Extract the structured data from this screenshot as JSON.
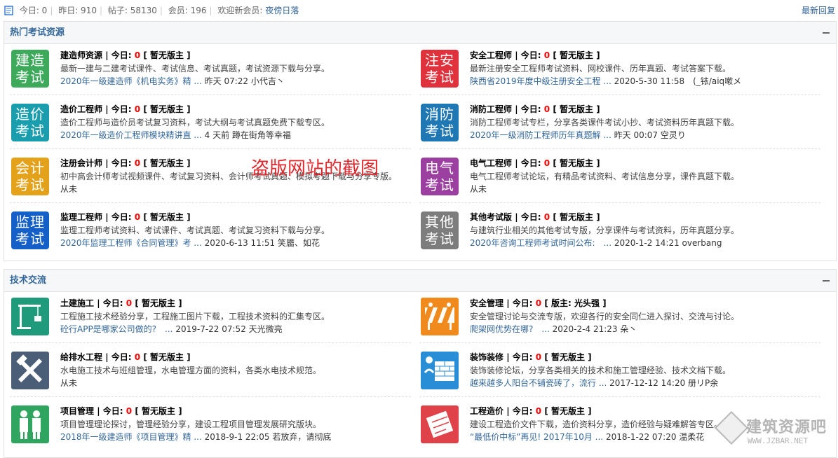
{
  "topbar": {
    "today_label": "今日: 0",
    "yesterday_label": "昨日: 910",
    "posts_label": "帖子: 58130",
    "members_label": "会员: 196",
    "welcome_label": "欢迎新会员:",
    "new_member": "夜傍日落",
    "latest_reply": "最新回复"
  },
  "annotation": "盗版网站的截图",
  "logo": {
    "main": "建筑资源吧",
    "sub": "WWW.JZBAR.NET"
  },
  "sections": [
    {
      "title": "热门考试资源",
      "forums": [
        {
          "icon_text": "建造考试",
          "icon_color": "#3daa5b",
          "name": "建造师资源",
          "today_label": "今日:",
          "today": "0",
          "moderator": "[ 暂无版主 ]",
          "desc": "最新一建与二建考试课件、考试信息、考试真题，考试资源下载与分享。",
          "last_title": "2020年一级建造师《机电实务》精 ...",
          "last_meta": "昨天 07:22 小代吉丶"
        },
        {
          "icon_text": "注安考试",
          "icon_color": "#e0323c",
          "name": "安全工程师",
          "today_label": "今日:",
          "today": "0",
          "moderator": "[ 暂无版主 ]",
          "desc": "最新注册安全工程师考试资料、网校课件、历年真题、考试答案下载。",
          "last_title": "陕西省2019年度中级注册安全工程 ...",
          "last_meta": "2020-5-30 11:58　(_铱/aiq嗽メ"
        },
        {
          "icon_text": "造价考试",
          "icon_color": "#1a9eae",
          "name": "造价工程师",
          "today_label": "今日:",
          "today": "0",
          "moderator": "[ 暂无版主 ]",
          "desc": "造价工程师与造价员考试复习资料，考试大纲与考试真题免费下载专区。",
          "last_title": "2020年一级造价工程师模块精讲直 ...",
          "last_meta": "4 天前 蹲在街角等幸福"
        },
        {
          "icon_text": "消防考试",
          "icon_color": "#1f78b4",
          "name": "消防工程师",
          "today_label": "今日:",
          "today": "0",
          "moderator": "[ 暂无版主 ]",
          "desc": "消防工程师考试专栏，分享各类课件考试小抄、考试资料历年真题下载。",
          "last_title": "2020年一级消防工程师历年真题解 ...",
          "last_meta": "昨天 00:07 空灵り"
        },
        {
          "icon_text": "会计考试",
          "icon_color": "#e3a21a",
          "name": "注册会计师",
          "today_label": "今日:",
          "today": "0",
          "moderator": "[ 暂无版主 ]",
          "desc": "初中高会计师考试视频课件、考试复习资料、会计师考试真题、模拟考题下载与分享专版。",
          "last_title": "",
          "last_meta": "从未"
        },
        {
          "icon_text": "电气考试",
          "icon_color": "#9b3fa0",
          "name": "电气工程师",
          "today_label": "今日:",
          "today": "0",
          "moderator": "[ 暂无版主 ]",
          "desc": "电气工程师考试论坛，有精品考试资料、考试信息分享，课件真题下载。",
          "last_title": "",
          "last_meta": "从未"
        },
        {
          "icon_text": "监理考试",
          "icon_color": "#1560c8",
          "name": "监理工程师",
          "today_label": "今日:",
          "today": "0",
          "moderator": "[ 暂无版主 ]",
          "desc": "监理工程师考试资料、考试课件、考试真题、考试复习资料下载与分享。",
          "last_title": "2020年监理工程师《合同管理》考 ...",
          "last_meta": "2020-6-13 11:51 笑靥、如花"
        },
        {
          "icon_text": "其他考试",
          "icon_color": "#7d7d7d",
          "name": "其他考试版",
          "today_label": "今日:",
          "today": "0",
          "moderator": "[ 暂无版主 ]",
          "desc": "与建筑行业相关的其他考试专版，分享课件与考试资料，历年真题分享。",
          "last_title": "2020年咨询工程师考试时间公布:　...",
          "last_meta": "2020-1-2 14:21 overbang"
        }
      ]
    },
    {
      "title": "技术交流",
      "forums": [
        {
          "icon_name": "crane-icon",
          "icon_color": "#1f9a7a",
          "name": "土建施工",
          "today_label": "今日:",
          "today": "0",
          "moderator": "[ 暂无版主 ]",
          "desc": "工程施工技术经验分享，工程施工图片下载，工程技术资料的汇集专区。",
          "last_title": "砼行APP是哪家公司做的?　...",
          "last_meta": "2019-7-22 07:52 天光微亮"
        },
        {
          "icon_name": "barrier-icon",
          "icon_color": "#f08a1d",
          "name": "安全管理",
          "today_label": "今日:",
          "today": "0",
          "moderator": "[ 版主: 光头强 ]",
          "desc": "安全管理讨论与交流专版，欢迎各行的安全同仁进入探讨、交流与讨论。",
          "last_title": "爬架网优势在哪?　...",
          "last_meta": "2020-2-4 21:23 朵丶"
        },
        {
          "icon_name": "tools-icon",
          "icon_color": "#4a5f77",
          "name": "给排水工程",
          "today_label": "今日:",
          "today": "0",
          "moderator": "[ 暂无版主 ]",
          "desc": "水电施工技术与班组管理，水电管理方面的资料，各类水电技术规范。",
          "last_title": "",
          "last_meta": "从未"
        },
        {
          "icon_name": "brickwall-icon",
          "icon_color": "#2a8ed6",
          "name": "装饰装修",
          "today_label": "今日:",
          "today": "0",
          "moderator": "[ 暂无版主 ]",
          "desc": "装饰装修论坛，分享各类相关的技术和施工管理经验、技术文档下载。",
          "last_title": "越来越多人阳台不铺瓷砖了，流行 ...",
          "last_meta": "2017-12-12 14:20 册リP余"
        },
        {
          "icon_name": "workers-icon",
          "icon_color": "#2fa560",
          "name": "项目管理",
          "today_label": "今日:",
          "today": "0",
          "moderator": "[ 暂无版主 ]",
          "desc": "项目管理理论探讨，管理经验分享，建设工程项目管理发展研究版块。",
          "last_title": "2018年一级建造师《项目管理》精 ...",
          "last_meta": "2018-9-1 22:05 若放弃，请彻底"
        },
        {
          "icon_name": "blueprint-icon",
          "icon_color": "#e0424a",
          "name": "工程造价",
          "today_label": "今日:",
          "today": "0",
          "moderator": "[ 暂无版主 ]",
          "desc": "建设工程造价文件下载，造价资料分享，造价经验与疑难解答专区。",
          "last_title": "“最低价中标”再见! 2017年10月 ...",
          "last_meta": "2018-1-22 07:20 温柔花"
        }
      ]
    }
  ]
}
